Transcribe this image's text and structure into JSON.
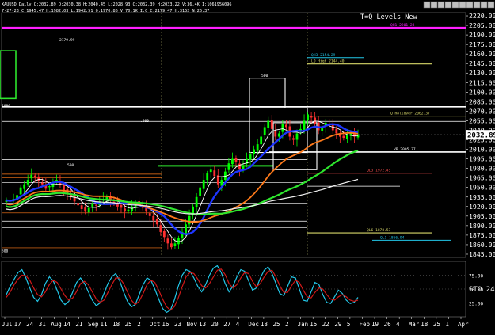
{
  "header": {
    "symbol_line": "XAUUSD  Daily  C:2032.89  O:2030.38  H:2040.45  L:2028.93  C:2032.39  H:2033.22  V:36.4K  I:1061956096",
    "study_line": "7-27-23  C:1945.47 H:1982.03 L:1942.51 O:1970.86 V:70.1K  I:0  C:2179.47  H:3152  N:26.37",
    "title": "T=Q Levels New",
    "toolbar_icons": [
      "window-icon",
      "up-icon",
      "down-icon",
      "dollar-icon",
      "bars-icon",
      "grid-icon",
      "link-icon",
      "minimize-icon",
      "maximize-icon",
      "close-icon"
    ]
  },
  "colors": {
    "background": "#000000",
    "candle_up": "#00ff00",
    "candle_down": "#ff3030",
    "ma_fast": "#ffffff",
    "ma_blue": "#1d35ff",
    "ma_orange": "#ff7a1a",
    "ma_green": "#2ee52e",
    "ma_slow": "#f0f0f0",
    "magenta_line": "#ff20ff",
    "sto_k": "#22c7e8",
    "sto_d": "#d01818",
    "price_tag_bg": "#ffffff"
  },
  "chart_data": [
    {
      "type": "candlestick",
      "title": "T=Q Levels New",
      "ylim": [
        1840,
        2225
      ],
      "y_ticks": [
        "2220.00",
        "2205.00",
        "2190.00",
        "2175.00",
        "2160.00",
        "2145.00",
        "2130.00",
        "2115.00",
        "2100.00",
        "2085.00",
        "2070.00",
        "2055.00",
        "2040.00",
        "2025.00",
        "2010.00",
        "1995.00",
        "1980.00",
        "1965.00",
        "1950.00",
        "1935.00",
        "1920.00",
        "1905.00",
        "1890.00",
        "1875.00",
        "1860.00",
        "1845.00"
      ],
      "last_price": "2032.89",
      "level_lines": [
        {
          "label": "QH1 2201.28",
          "value": 2201.28,
          "color": "#ff20ff"
        },
        {
          "label": "QH3 2154.29",
          "value": 2154.29,
          "color": "#22c7e8"
        },
        {
          "label": "LO High 2144.40",
          "value": 2144.4,
          "color": "#d8d86a"
        },
        {
          "label": "Q Rollover 2062.37",
          "value": 2062.37,
          "color": "#d8d86a"
        },
        {
          "label": "VP 2005.77",
          "value": 2005.77,
          "color": "#ffffff"
        },
        {
          "label": "QL3 1972.45",
          "value": 1972.45,
          "color": "#ff5050"
        },
        {
          "label": "QL6 1878.53",
          "value": 1878.53,
          "color": "#d8d86a"
        },
        {
          "label": "QL1 1866.94",
          "value": 1866.94,
          "color": "#22c7e8"
        }
      ],
      "left_labels": [
        {
          "text": "2179.99",
          "value": 2179.99
        },
        {
          "text": "500",
          "value": 2124
        },
        {
          "text": ".500",
          "value": 2053
        },
        {
          "text": "2080",
          "value": 2077
        },
        {
          "text": "500",
          "value": 1983
        },
        {
          "text": "500",
          "value": 1848
        }
      ],
      "x_labels": [
        "Jul",
        "17",
        "24",
        "31",
        "Aug",
        "14",
        "21",
        "Sep",
        "11",
        "18",
        "25",
        "2",
        "Oct",
        "16",
        "23",
        "Nov",
        "13",
        "20",
        "27",
        "4",
        "Dec",
        "18",
        "25",
        "2",
        "Jan",
        "15",
        "22",
        "29",
        "5",
        "Feb",
        "19",
        "26",
        "4",
        "Mar",
        "18",
        "25",
        "1",
        "Apr"
      ],
      "series": [
        {
          "name": "close",
          "values": [
            1930,
            1928,
            1932,
            1938,
            1950,
            1955,
            1962,
            1970,
            1966,
            1960,
            1955,
            1948,
            1952,
            1958,
            1962,
            1955,
            1945,
            1940,
            1935,
            1928,
            1922,
            1916,
            1912,
            1918,
            1925,
            1922,
            1928,
            1932,
            1935,
            1930,
            1925,
            1920,
            1918,
            1912,
            1915,
            1920,
            1926,
            1922,
            1918,
            1912,
            1905,
            1898,
            1892,
            1880,
            1872,
            1862,
            1856,
            1862,
            1870,
            1880,
            1892,
            1905,
            1920,
            1935,
            1950,
            1962,
            1972,
            1978,
            1968,
            1955,
            1962,
            1975,
            1988,
            1995,
            1990,
            1978,
            1985,
            1995,
            2002,
            2010,
            2018,
            2030,
            2045,
            2055,
            2042,
            2030,
            2035,
            2050,
            2045,
            2030,
            2025,
            2035,
            2042,
            2055,
            2065,
            2060,
            2050,
            2040,
            2045,
            2052,
            2048,
            2040,
            2035,
            2030,
            2028,
            2032,
            2035,
            2030,
            2032.89
          ]
        }
      ]
    },
    {
      "type": "line",
      "title": "",
      "ylim": [
        0,
        100
      ],
      "y_ticks": [
        "75.00",
        "50.00",
        "25.00"
      ],
      "label": "STO 24.",
      "series": [
        {
          "name": "%K",
          "values": [
            40,
            55,
            68,
            80,
            85,
            70,
            52,
            35,
            28,
            40,
            60,
            72,
            65,
            48,
            30,
            22,
            28,
            45,
            62,
            70,
            60,
            45,
            30,
            20,
            25,
            42,
            60,
            72,
            78,
            65,
            45,
            28,
            18,
            22,
            40,
            58,
            70,
            66,
            50,
            32,
            15,
            8,
            12,
            30,
            55,
            75,
            85,
            82,
            70,
            55,
            45,
            58,
            75,
            88,
            92,
            80,
            60,
            45,
            55,
            72,
            85,
            82,
            65,
            48,
            52,
            70,
            84,
            90,
            78,
            60,
            42,
            38,
            55,
            72,
            70,
            50,
            30,
            28,
            45,
            62,
            58,
            40,
            26,
            24,
            36,
            48,
            42,
            30,
            24,
            26,
            35
          ]
        },
        {
          "name": "%D",
          "values": [
            35,
            45,
            58,
            68,
            75,
            74,
            66,
            52,
            40,
            36,
            45,
            58,
            66,
            62,
            50,
            38,
            30,
            34,
            46,
            60,
            64,
            58,
            45,
            32,
            26,
            30,
            44,
            58,
            70,
            70,
            60,
            45,
            30,
            22,
            28,
            42,
            58,
            66,
            62,
            48,
            32,
            18,
            12,
            18,
            34,
            54,
            72,
            80,
            78,
            68,
            56,
            52,
            60,
            72,
            84,
            86,
            76,
            60,
            52,
            58,
            70,
            80,
            78,
            64,
            54,
            60,
            72,
            82,
            84,
            72,
            56,
            44,
            44,
            56,
            66,
            62,
            48,
            36,
            34,
            44,
            52,
            50,
            40,
            32,
            30,
            36,
            40,
            36,
            30,
            28,
            30
          ]
        }
      ]
    }
  ],
  "footer": {
    "scroll_left": "◄",
    "scroll_right": "►"
  }
}
